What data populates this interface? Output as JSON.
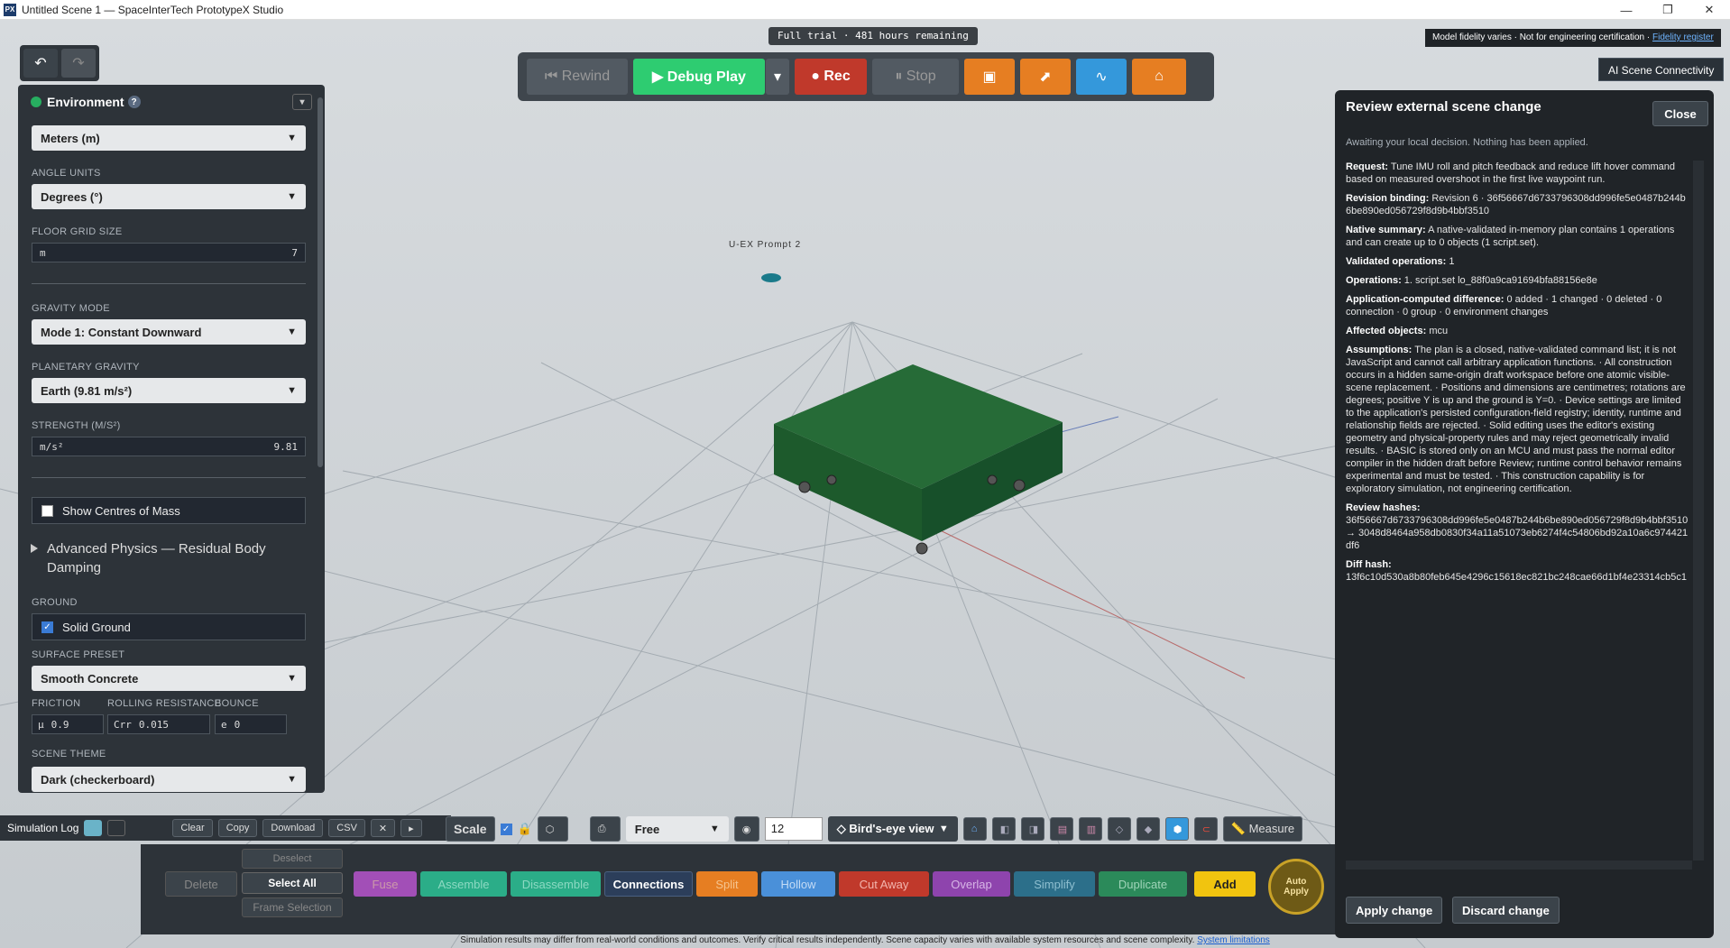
{
  "window": {
    "title": "Untitled Scene 1 — SpaceInterTech PrototypeX Studio",
    "app_icon": "PX",
    "minimize": "—",
    "maximize": "❐",
    "close": "✕"
  },
  "trial_badge": "Full trial · 481 hours remaining",
  "fidelity": {
    "text": "Model fidelity varies · Not for engineering certification ·",
    "link": "Fidelity register"
  },
  "ai_connectivity": "AI Scene Connectivity",
  "toolbar": {
    "rewind": "⏮ Rewind",
    "debug_play": "▶ Debug Play",
    "dropdown": "▾",
    "rec": "● Rec",
    "stop": "⏸ Stop",
    "icons": [
      "image-icon",
      "chart-icon",
      "pulse-icon",
      "home-icon"
    ]
  },
  "undo": {
    "undo": "↶",
    "redo": "↷"
  },
  "environment": {
    "title": "Environment",
    "help": "?",
    "units": "Meters (m)",
    "angle_units_label": "ANGLE UNITS",
    "angle_units": "Degrees (°)",
    "floor_grid_label": "FLOOR GRID SIZE",
    "floor_grid_unit": "m",
    "floor_grid_value": "7",
    "gravity_mode_label": "GRAVITY MODE",
    "gravity_mode": "Mode 1: Constant Downward",
    "planetary_gravity_label": "PLANETARY GRAVITY",
    "planetary_gravity": "Earth (9.81 m/s²)",
    "strength_label": "STRENGTH (M/S²)",
    "strength_unit": "m/s²",
    "strength_value": "9.81",
    "show_com": "Show Centres of Mass",
    "advanced": "Advanced Physics — Residual Body Damping",
    "ground_label": "GROUND",
    "solid_ground": "Solid Ground",
    "surface_label": "SURFACE PRESET",
    "surface": "Smooth Concrete",
    "friction_label": "FRICTION",
    "rolling_label": "ROLLING RESISTANCE",
    "bounce_label": "BOUNCE",
    "friction_sym": "μ",
    "friction_value": "0.9",
    "rolling_sym": "Crr",
    "rolling_value": "0.015",
    "bounce_sym": "e",
    "bounce_value": "0",
    "theme_label": "SCENE THEME",
    "theme": "Dark (checkerboard)"
  },
  "log": {
    "label": "Simulation Log",
    "clear": "Clear",
    "copy": "Copy",
    "download": "Download",
    "csv": "CSV",
    "x": "✕",
    "play": "▸"
  },
  "bottom": {
    "scale": "Scale",
    "free": "Free",
    "grid_value": "12",
    "view": "◇ Bird's-eye view",
    "measure": "📏 Measure",
    "deselect": "Deselect",
    "select_all": "Select All",
    "frame_selection": "Frame Selection",
    "delete": "Delete",
    "fuse": "Fuse",
    "assemble": "Assemble",
    "disassemble": "Disassemble",
    "connections": "Connections",
    "split": "Split",
    "hollow": "Hollow",
    "cut_away": "Cut Away",
    "overlap": "Overlap",
    "simplify": "Simplify",
    "duplicate": "Duplicate",
    "add": "Add",
    "auto_apply_1": "Auto",
    "auto_apply_2": "Apply"
  },
  "scene": {
    "object_label": "U-EX Prompt 2"
  },
  "review": {
    "title": "Review external scene change",
    "close": "Close",
    "subtitle": "Awaiting your local decision. Nothing has been applied.",
    "request_k": "Request:",
    "request_v": "Tune IMU roll and pitch feedback and reduce lift hover command based on measured overshoot in the first live waypoint run.",
    "binding_k": "Revision binding:",
    "binding_v": "Revision 6 · 36f56667d6733796308dd996fe5e0487b244b6be890ed056729f8d9b4bbf3510",
    "native_k": "Native summary:",
    "native_v": "A native-validated in-memory plan contains 1 operations and can create up to 0 objects (1 script.set).",
    "validated_k": "Validated operations:",
    "validated_v": "1",
    "operations_k": "Operations:",
    "operations_v": "1. script.set lo_88f0a9ca91694bfa88156e8e",
    "diff_k": "Application-computed difference:",
    "diff_v": "0 added · 1 changed · 0 deleted · 0 connection · 0 group · 0 environment changes",
    "affected_k": "Affected objects:",
    "affected_v": "mcu",
    "assumptions_k": "Assumptions:",
    "assumptions_v": "The plan is a closed, native-validated command list; it is not JavaScript and cannot call arbitrary application functions. · All construction occurs in a hidden same-origin draft workspace before one atomic visible-scene replacement. · Positions and dimensions are centimetres; rotations are degrees; positive Y is up and the ground is Y=0. · Device settings are limited to the application's persisted configuration-field registry; identity, runtime and relationship fields are rejected. · Solid editing uses the editor's existing geometry and physical-property rules and may reject geometrically invalid results. · BASIC is stored only on an MCU and must pass the normal editor compiler in the hidden draft before Review; runtime control behavior remains experimental and must be tested. · This construction capability is for exploratory simulation, not engineering certification.",
    "hashes_k": "Review hashes:",
    "hashes_v": "36f56667d6733796308dd996fe5e0487b244b6be890ed056729f8d9b4bbf3510 → 3048d8464a958db0830f34a11a51073eb6274f4c54806bd92a10a6c974421df6",
    "diffhash_k": "Diff hash:",
    "diffhash_v": "13f6c10d530a8b80feb645e4296c15618ec821bc248cae66d1bf4e23314cb5c1",
    "apply": "Apply change",
    "discard": "Discard change"
  },
  "footer": {
    "text": "Simulation results may differ from real-world conditions and outcomes. Verify critical results independently. Scene capacity varies with available system resources and scene complexity.",
    "link": "System limitations"
  },
  "colors": {
    "accent_green": "#2ecc71",
    "rec_red": "#c0392b",
    "orange": "#e67e22",
    "blue": "#3498db",
    "box_green": "#1f5e2f"
  }
}
